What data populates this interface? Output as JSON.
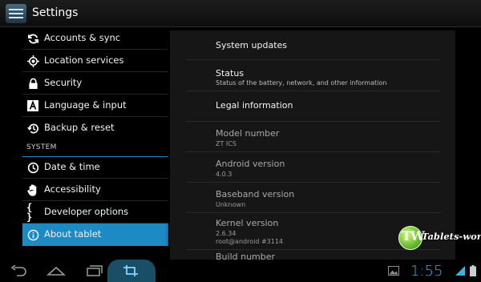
{
  "action_bar": {
    "title": "Settings",
    "icon": "settings-sliders-icon"
  },
  "sidebar": {
    "items": [
      {
        "label": "Accounts & sync",
        "icon": "sync-icon"
      },
      {
        "label": "Location services",
        "icon": "location-target-icon"
      },
      {
        "label": "Security",
        "icon": "lock-icon"
      },
      {
        "label": "Language & input",
        "icon": "keyboard-a-icon"
      },
      {
        "label": "Backup & reset",
        "icon": "restore-clock-icon"
      }
    ],
    "section_header": "SYSTEM",
    "system_items": [
      {
        "label": "Date & time",
        "icon": "clock-icon"
      },
      {
        "label": "Accessibility",
        "icon": "hand-icon"
      },
      {
        "label": "Developer options",
        "icon": "braces-icon"
      },
      {
        "label": "About tablet",
        "icon": "info-icon",
        "selected": true
      }
    ]
  },
  "about": {
    "items": [
      {
        "title": "System updates",
        "summary": ""
      },
      {
        "title": "Status",
        "summary": "Status of the battery, network, and other information"
      },
      {
        "title": "Legal information",
        "summary": ""
      },
      {
        "title": "Model number",
        "summary": "ZT ICS"
      },
      {
        "title": "Android version",
        "summary": "4.0.3"
      },
      {
        "title": "Baseband version",
        "summary": "Unknown"
      },
      {
        "title": "Kernel version",
        "summary": "2.6.34",
        "summary2": "root@android #3114"
      },
      {
        "title": "Build number",
        "summary": ""
      }
    ]
  },
  "nav_bar": {
    "clock": "1:55",
    "buttons": [
      "back-icon",
      "home-icon",
      "recent-apps-icon",
      "screenshot-crop-icon"
    ],
    "accent": "#33b5e5"
  },
  "watermark": {
    "logo": "TW",
    "text": "Tablets-world"
  },
  "colors": {
    "selected": "#1e8ac4",
    "accent": "#33b5e5"
  }
}
